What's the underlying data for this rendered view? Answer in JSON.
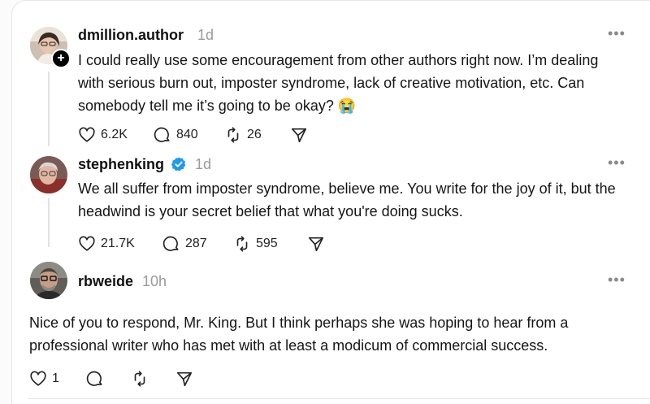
{
  "posts": [
    {
      "username": "dmillion.author",
      "time": "1d",
      "text": "I could really use some encouragement from other authors right now. I’m dealing with serious burn out, imposter syndrome, lack of creative motivation, etc. Can somebody tell me it’s going to be okay? 😭",
      "likes": "6.2K",
      "replies": "840",
      "reposts": "26"
    },
    {
      "username": "stephenking",
      "time": "1d",
      "text": "We all suffer from imposter syndrome, believe me. You write for the joy of it, but the headwind is your secret belief that what you're doing sucks.",
      "likes": "21.7K",
      "replies": "287",
      "reposts": "595"
    },
    {
      "username": "rbweide",
      "time": "10h",
      "text": "Nice of you to respond, Mr. King. But I think perhaps she was hoping to hear from a professional writer who has met with at least a modicum of commercial success.",
      "likes": "1"
    }
  ],
  "more_label": "•••",
  "colors": {
    "verified": "#1d9bf0",
    "meta": "#9a9a9a"
  },
  "icons": [
    "heart-icon",
    "comment-icon",
    "repost-icon",
    "share-icon",
    "verified-icon",
    "follow-plus-icon",
    "more-icon"
  ]
}
